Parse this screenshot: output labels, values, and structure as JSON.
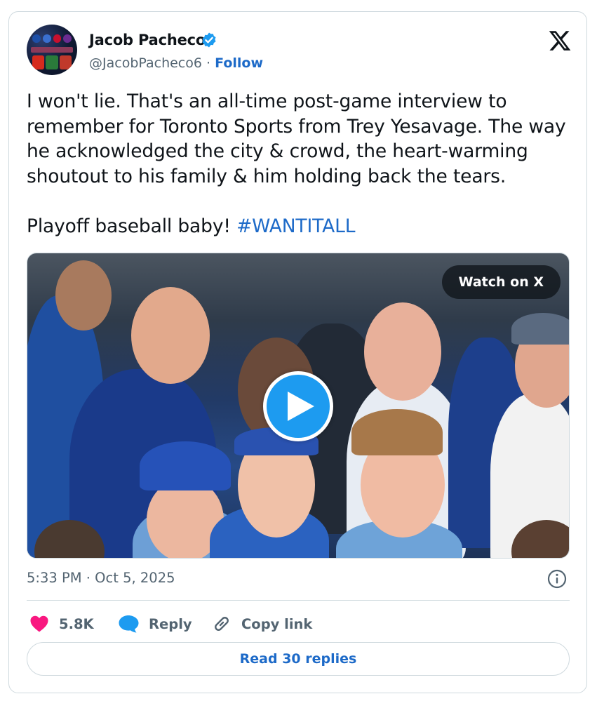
{
  "author": {
    "name": "Jacob Pacheco",
    "handle": "@JacobPacheco6",
    "separator": "·",
    "follow_label": "Follow",
    "verified": true
  },
  "tweet": {
    "paragraph_1": "I won't lie. That's an all-time post-game interview to remember for Toronto Sports from Trey Yesavage. The way he acknowledged the city & crowd, the heart-warming shoutout to his family & him holding back the tears.",
    "paragraph_2_text": "Playoff baseball baby! ",
    "hashtag": "#WANTITALL"
  },
  "media": {
    "watch_label": "Watch on X",
    "type": "video"
  },
  "meta": {
    "timestamp": "5:33 PM · Oct 5, 2025"
  },
  "actions": {
    "like_count": "5.8K",
    "reply_label": "Reply",
    "copy_link_label": "Copy link"
  },
  "footer": {
    "read_replies_label": "Read 30 replies"
  },
  "colors": {
    "link": "#1d6ac8",
    "like": "#f91880",
    "reply_icon": "#1d9bf0",
    "muted": "#536471",
    "border": "#cfd9de"
  },
  "icons": {
    "brand": "x-logo-icon",
    "verified": "verified-badge-icon",
    "play": "play-icon",
    "info": "info-icon",
    "like": "heart-icon",
    "reply": "speech-bubble-icon",
    "copy": "link-icon"
  }
}
